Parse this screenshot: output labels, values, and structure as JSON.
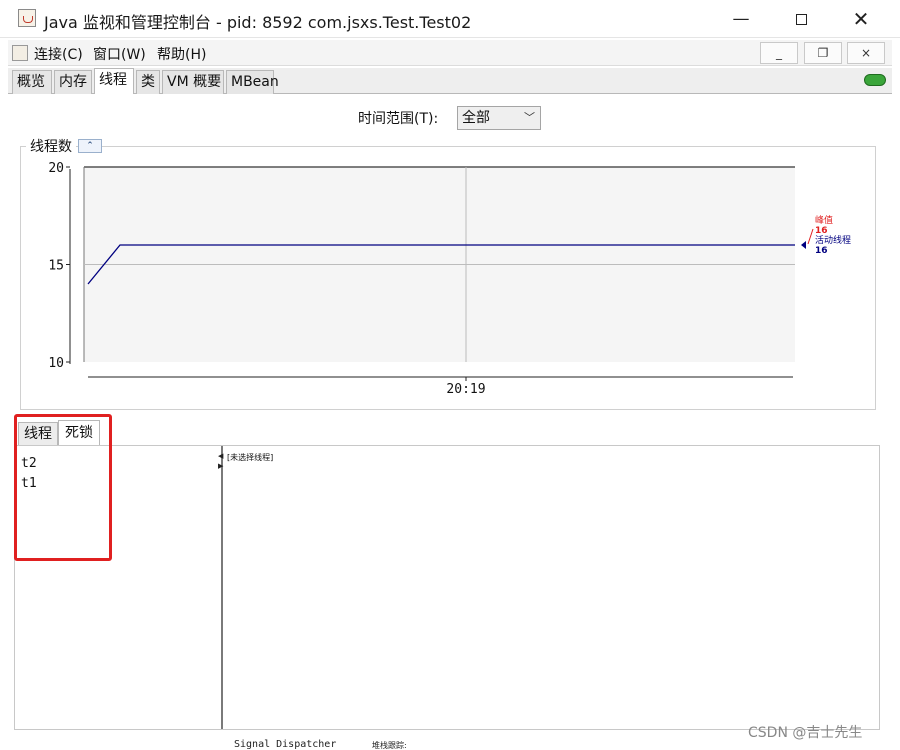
{
  "window": {
    "title": "Java 监视和管理控制台 - pid: 8592 com.jsxs.Test.Test02",
    "minimize": "—",
    "close": "✕"
  },
  "menu": {
    "connect": "连接(C)",
    "window": "窗口(W)",
    "help": "帮助(H)",
    "mdi_min": "_",
    "mdi_restore": "❐",
    "mdi_close": "×"
  },
  "tabs": [
    {
      "label": "概览"
    },
    {
      "label": "内存"
    },
    {
      "label": "线程"
    },
    {
      "label": "类"
    },
    {
      "label": "VM 概要"
    },
    {
      "label": "MBean"
    }
  ],
  "time_range": {
    "label": "时间范围(T):",
    "selected": "全部"
  },
  "thread_chart": {
    "title": "线程数",
    "collapse_symbol": "⌃"
  },
  "chart_data": {
    "type": "line",
    "x": [
      "",
      "",
      "20:19",
      ""
    ],
    "xtick_labels": [
      "20:19"
    ],
    "ylim": [
      10,
      20
    ],
    "yticks": [
      10,
      15,
      20
    ],
    "series": [
      {
        "name": "活动线程",
        "values": [
          14,
          16,
          16,
          16
        ],
        "color": "#000080"
      }
    ],
    "legend": [
      {
        "label": "峰值",
        "value": "16",
        "color": "#e02020"
      },
      {
        "label": "活动线程",
        "value": "16",
        "color": "#000080"
      }
    ],
    "grid": true,
    "legend_position": "right"
  },
  "lower": {
    "tab_threads": "线程",
    "tab_deadlock": "死锁",
    "threads": [
      "t2",
      "t1"
    ],
    "detail_placeholder": "[未选择线程]"
  },
  "bottom": {
    "strip_text_1": "Signal Dispatcher",
    "strip_text_2": "堆栈跟踪:",
    "watermark": "CSDN @吉士先生"
  },
  "colors": {
    "highlight": "#e02020",
    "series_line": "#000080",
    "peak": "#e02020"
  }
}
